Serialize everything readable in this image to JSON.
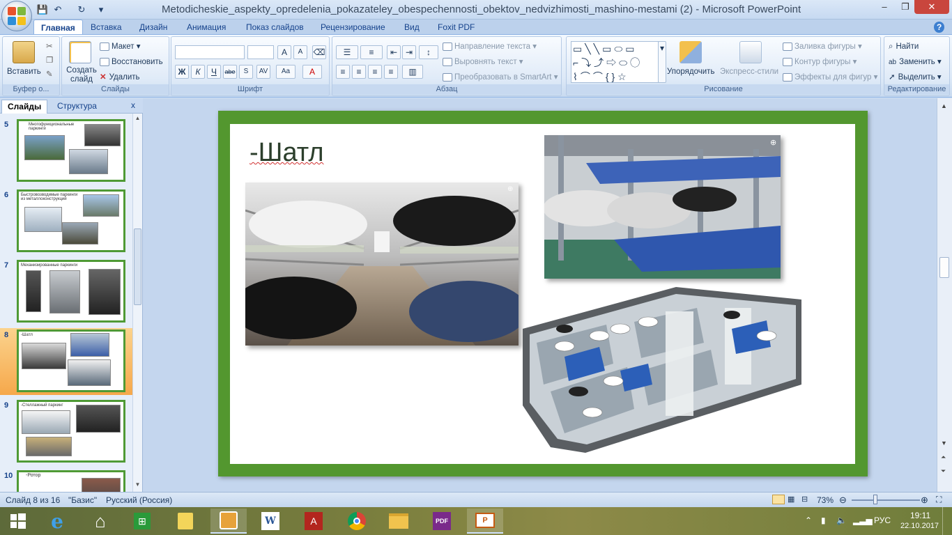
{
  "window": {
    "title": "Metodicheskie_aspekty_opredelenia_pokazateley_obespechennosti_obektov_nedvizhimosti_mashino-mestami (2) - Microsoft PowerPoint",
    "minimize": "‒",
    "restore": "❐",
    "close": "✕"
  },
  "qat": {
    "save": "💾",
    "undo": "↶",
    "redo": "↻",
    "more": "▾"
  },
  "tabs": [
    "Главная",
    "Вставка",
    "Дизайн",
    "Анимация",
    "Показ слайдов",
    "Рецензирование",
    "Вид",
    "Foxit PDF"
  ],
  "help": "?",
  "ribbon": {
    "clipboard": {
      "label": "Буфер о...",
      "paste": "Вставить"
    },
    "slides": {
      "label": "Слайды",
      "new_slide": "Создать слайд",
      "layout": "Макет",
      "reset": "Восстановить",
      "delete": "Удалить"
    },
    "font": {
      "label": "Шрифт",
      "bold": "Ж",
      "italic": "К",
      "underline": "Ч",
      "strike": "abe",
      "grow": "A",
      "shrink": "A",
      "case": "Aa"
    },
    "paragraph": {
      "label": "Абзац",
      "text_direction": "Направление текста",
      "align_text": "Выровнять текст",
      "smartart": "Преобразовать в SmartArt"
    },
    "drawing": {
      "label": "Рисование",
      "arrange": "Упорядочить",
      "quick_styles": "Экспресс-стили",
      "fill": "Заливка фигуры",
      "outline": "Контур фигуры",
      "effects": "Эффекты для фигур"
    },
    "editing": {
      "label": "Редактирование",
      "find": "Найти",
      "replace": "Заменить",
      "select": "Выделить"
    }
  },
  "panel": {
    "tab_slides": "Слайды",
    "tab_outline": "Структура",
    "close": "x",
    "thumbs": [
      {
        "num": "5",
        "title": "Многофункциональные паркинги",
        "selected": false
      },
      {
        "num": "6",
        "title": "Быстровозводимые паркинги из металлоконструкций",
        "selected": false
      },
      {
        "num": "7",
        "title": "Механизированные паркинги",
        "selected": false
      },
      {
        "num": "8",
        "title": "-Шатл",
        "selected": true
      },
      {
        "num": "9",
        "title": "-Стеллажный паркинг",
        "selected": false
      },
      {
        "num": "10",
        "title": "-Ротор",
        "selected": false
      }
    ]
  },
  "slide": {
    "title": "-Шатл"
  },
  "status": {
    "slide_of": "Слайд 8 из 16",
    "theme": "\"Базис\"",
    "language": "Русский (Россия)",
    "zoom": "73%",
    "zoom_level": 0.73
  },
  "taskbar": {
    "lang": "РУС",
    "time": "19:11",
    "date": "22.10.2017"
  },
  "colors": {
    "slide_frame": "#53972f",
    "ribbon_text": "#15428b",
    "selected_thumb": "#f6a84b"
  }
}
